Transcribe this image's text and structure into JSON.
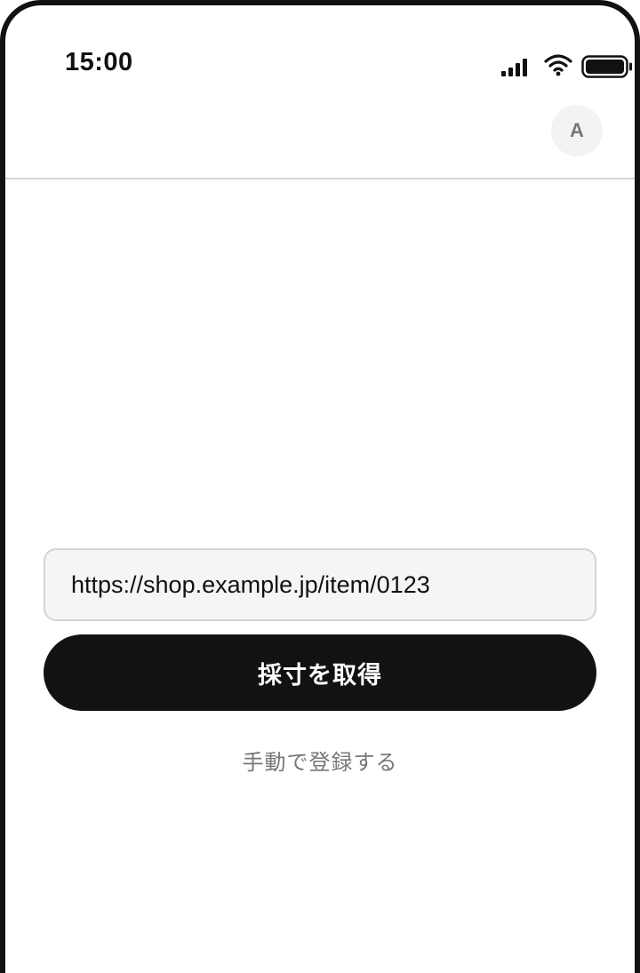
{
  "status_bar": {
    "time": "15:00",
    "icons": [
      "signal-icon",
      "wifi-icon",
      "battery-icon"
    ]
  },
  "header": {
    "avatar_initial": "A"
  },
  "form": {
    "url_value": "https://shop.example.jp/item/0123",
    "fetch_button_label": "採寸を取得",
    "manual_link_label": "手動で登録する"
  },
  "colors": {
    "primary_button": "#121212",
    "input_background": "#f5f5f5",
    "link_text": "#777777"
  }
}
